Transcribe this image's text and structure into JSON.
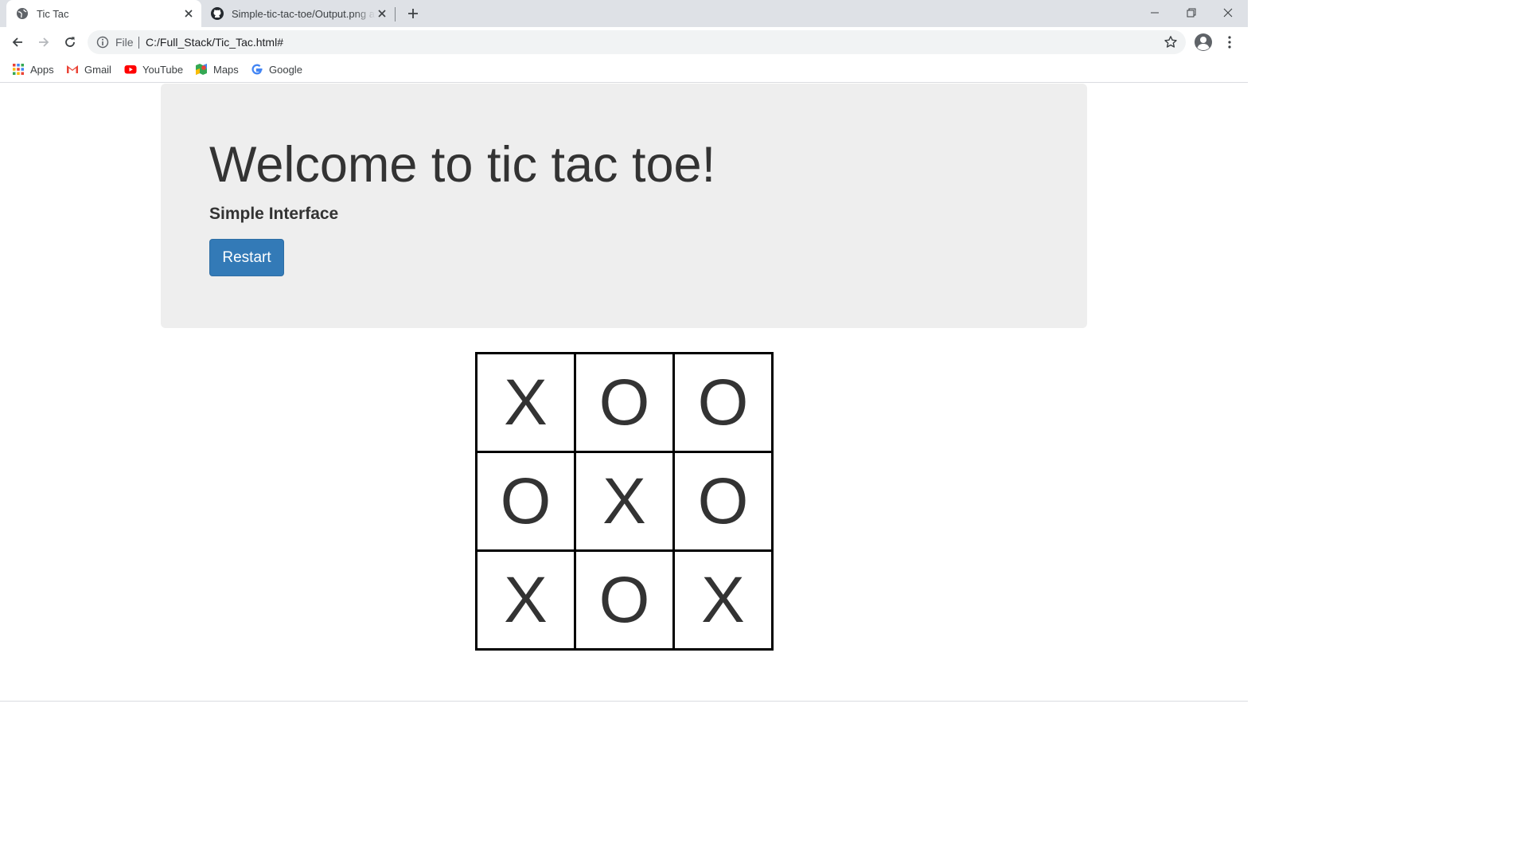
{
  "browser": {
    "tabs": [
      {
        "title": "Tic Tac",
        "active": true,
        "icon": "globe-icon"
      },
      {
        "title": "Simple-tic-tac-toe/Output.png at",
        "active": false,
        "icon": "github-icon"
      }
    ],
    "address": {
      "scheme": "File",
      "url": "C:/Full_Stack/Tic_Tac.html#"
    },
    "bookmarks": [
      {
        "label": "Apps",
        "icon": "apps-grid-icon"
      },
      {
        "label": "Gmail",
        "icon": "gmail-icon"
      },
      {
        "label": "YouTube",
        "icon": "youtube-icon"
      },
      {
        "label": "Maps",
        "icon": "maps-icon"
      },
      {
        "label": "Google",
        "icon": "google-icon"
      }
    ]
  },
  "page": {
    "heading": "Welcome to tic tac toe!",
    "subheading": "Simple Interface",
    "restart_label": "Restart",
    "board": [
      [
        "X",
        "O",
        "O"
      ],
      [
        "O",
        "X",
        "O"
      ],
      [
        "X",
        "O",
        "X"
      ]
    ]
  },
  "colors": {
    "jumbotron_bg": "#eeeeee",
    "button_primary": "#337ab7",
    "board_lines": "#000000",
    "text": "#333333"
  }
}
